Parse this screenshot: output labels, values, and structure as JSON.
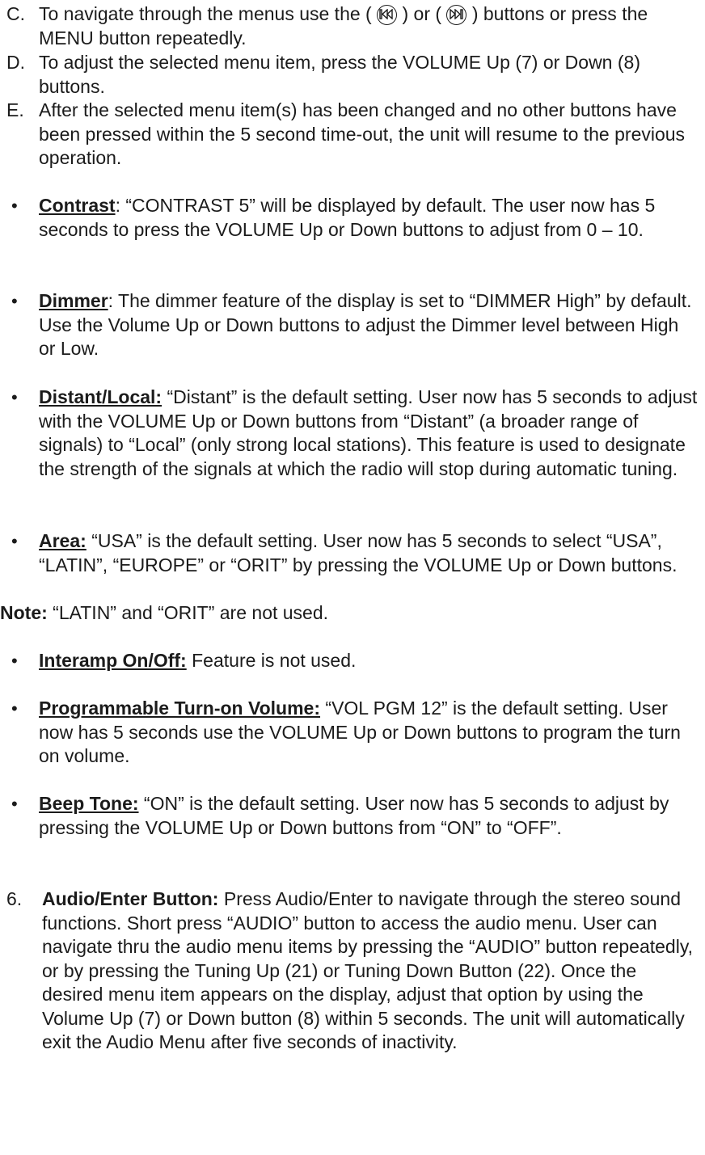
{
  "list_c": {
    "label": "C.",
    "before_icon1": "To navigate through the menus use the ( ",
    "between_icons": " ) or ( ",
    "after_icon2": " ) buttons or press the MENU button repeatedly.",
    "icon1": "previous-track-icon",
    "icon2": "next-track-icon"
  },
  "list_d": {
    "label": "D.",
    "text": "To adjust the selected menu item, press the VOLUME Up (7) or Down (8) buttons."
  },
  "list_e": {
    "label": "E.",
    "text": "After the selected menu item(s) has been changed and no other buttons have been pressed within the 5 second time-out, the unit will resume to the previous operation."
  },
  "bullets": [
    {
      "title": "Contrast",
      "sep": ": ",
      "text": "“CONTRAST 5” will be displayed by default. The user now has 5 seconds to press the VOLUME Up or Down buttons to adjust from 0 – 10."
    },
    {
      "title": "Dimmer",
      "sep": ": ",
      "text": "The dimmer feature of the display is set to “DIMMER High” by default. Use the Volume Up or Down buttons to adjust the Dimmer level between High or Low."
    },
    {
      "title": "Distant/Local:",
      "sep": " ",
      "text": "“Distant” is the default setting. User now has 5 seconds to adjust with the VOLUME Up or Down buttons from “Distant” (a broader range of signals) to “Local” (only strong local stations). This feature is used to designate the strength of the signals at which the radio will stop during automatic tuning."
    },
    {
      "title": "Area:",
      "sep": " ",
      "text": "“USA” is the default setting. User now has 5 seconds to select “USA”, “LATIN”, “EUROPE” or “ORIT” by pressing the VOLUME Up or Down buttons."
    }
  ],
  "note": {
    "label": "Note:",
    "text": " “LATIN” and “ORIT” are not used."
  },
  "bullets2": [
    {
      "title": "Interamp On/Off:",
      "sep": " ",
      "text": "Feature is not used."
    },
    {
      "title": "Programmable Turn-on Volume:",
      "sep": " ",
      "text": "“VOL PGM 12” is the default setting. User now has 5 seconds use the VOLUME Up or Down buttons to program the turn on volume."
    },
    {
      "title": "Beep Tone:",
      "sep": " ",
      "text": "“ON” is the default setting. User now has 5 seconds to adjust by pressing the VOLUME Up or Down buttons from “ON” to “OFF”."
    }
  ],
  "item6": {
    "number": "6.",
    "title": "Audio/Enter Button:",
    "text": " Press Audio/Enter to navigate through the stereo sound functions. Short press “AUDIO” button to access the audio menu. User can navigate thru the audio menu items by pressing the “AUDIO” button repeatedly, or by pressing the Tuning Up (21) or Tuning Down Button (22). Once the desired menu item appears on the display, adjust that option by using the Volume Up (7) or Down button (8) within 5 seconds. The unit will automatically exit the Audio Menu after five seconds of inactivity."
  },
  "bullet_glyph": "•"
}
